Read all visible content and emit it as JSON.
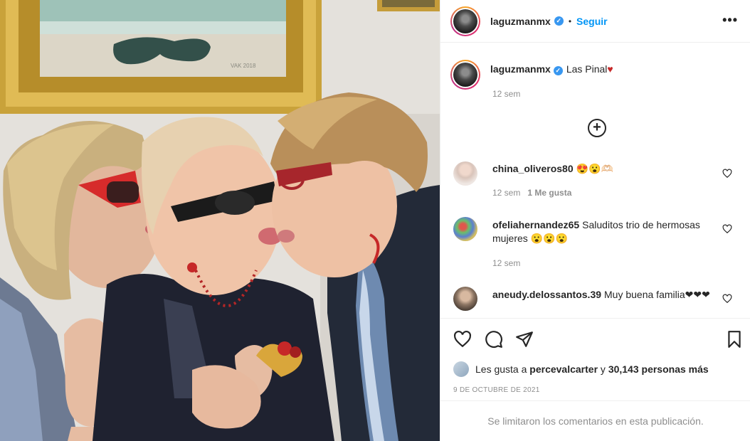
{
  "post": {
    "author": "laguzmanmx",
    "verified_mark": "✓",
    "separator": "•",
    "follow_label": "Seguir",
    "more_label": "•••",
    "caption_text": "Las Pinal",
    "caption_emoji": "♥",
    "caption_time": "12 sem",
    "load_more_label": "+",
    "photo_watermark": "VAK 2018",
    "icons": {
      "like": "heart-icon",
      "comment": "comment-icon",
      "share": "paper-plane-icon",
      "save": "bookmark-icon",
      "more": "ellipsis-icon",
      "verified": "verified-badge-icon",
      "load_more": "plus-circle-icon"
    },
    "colors": {
      "accent": "#0095f6",
      "verified": "#3897f0",
      "heart": "#c62828",
      "muted": "#8e8e8e"
    }
  },
  "comments": [
    {
      "user": "china_oliveros80",
      "text": "😍😮🫶🏻",
      "time": "12 sem",
      "likes": "1 Me gusta"
    },
    {
      "user": "ofeliahernandez65",
      "text": "Saluditos trio de hermosas mujeres 😮😮😮",
      "time": "12 sem",
      "likes": ""
    },
    {
      "user": "aneudy.delossantos.39",
      "text": "Muy buena familia❤❤❤",
      "time": "",
      "likes": ""
    }
  ],
  "likes": {
    "prefix": "Les gusta a",
    "user": "percevalcarter",
    "connector": "y",
    "count": "30,143 personas más"
  },
  "date": "9 DE OCTUBRE DE 2021",
  "comments_limited": "Se limitaron los comentarios en esta publicación."
}
